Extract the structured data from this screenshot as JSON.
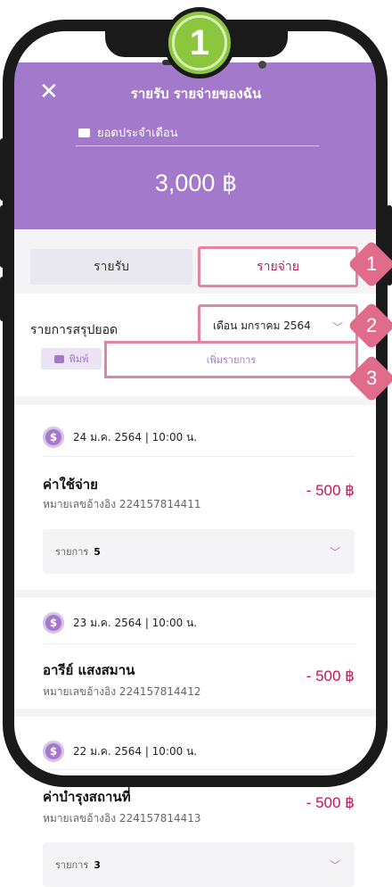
{
  "step_badge": "1",
  "header": {
    "title": "รายรับ รายจ่ายของฉัน",
    "balance_label": "ยอดประจำเดือน",
    "balance_amount": "3,000 ฿"
  },
  "tabs": [
    {
      "label": "รายรับ"
    },
    {
      "label": "รายจ่าย"
    }
  ],
  "summary": {
    "label": "รายการสรุปยอด",
    "month_value": "เดือน มกราคม 2564"
  },
  "actions": {
    "print_label": "พิมพ์",
    "add_label": "เพิ่มรายการ"
  },
  "callouts": [
    "1",
    "2",
    "3"
  ],
  "transactions": [
    {
      "date": "24 ม.ค. 2564  |  10:00 น.",
      "name": "ค่าใช้จ่าย",
      "ref": "หมายเลขอ้างอิง  224157814411",
      "amount": "- 500 ฿",
      "items_label": "รายการ",
      "items_count": "5"
    },
    {
      "date": "23 ม.ค. 2564  |  10:00 น.",
      "name": "อารีย์  แสงสมาน",
      "ref": "หมายเลขอ้างอิง  224157814412",
      "amount": "- 500 ฿"
    },
    {
      "date": "22 ม.ค. 2564  |  10:00 น.",
      "name": "ค่าบำรุงสถานที่",
      "ref": "หมายเลขอ้างอิง  224157814413",
      "amount": "- 500 ฿",
      "items_label": "รายการ",
      "items_count": "3"
    }
  ],
  "colors": {
    "primary": "#a379cc",
    "accent": "#c0165f",
    "highlight": "#e8839f",
    "badge": "#8cc63f"
  }
}
